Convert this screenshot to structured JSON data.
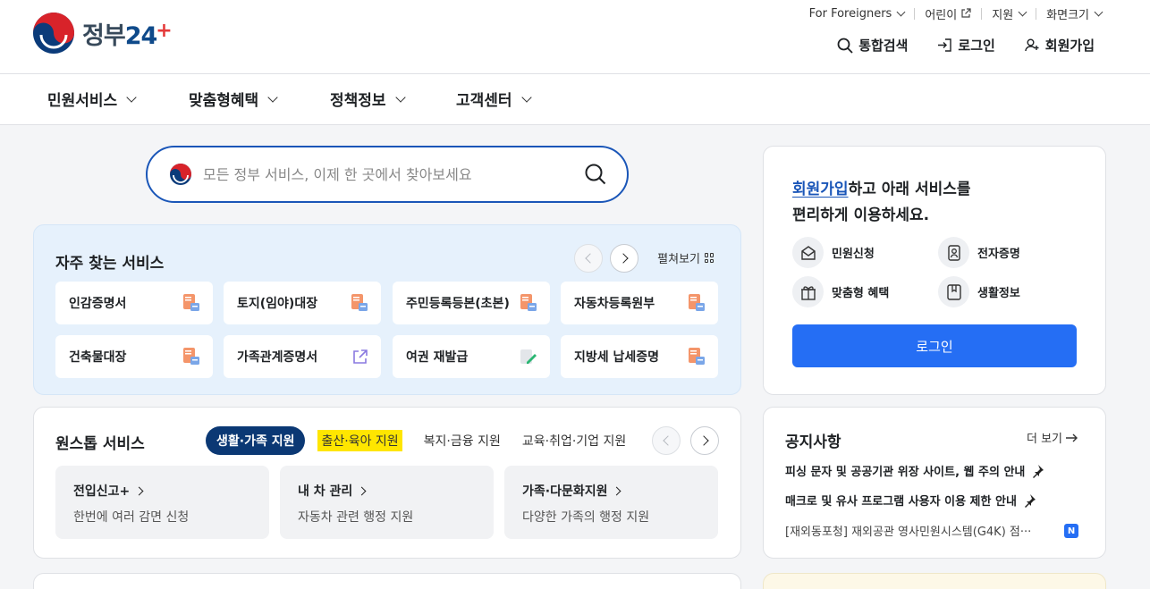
{
  "header": {
    "logo_text": "정부",
    "logo_num": "24",
    "logo_plus": "+",
    "util": [
      {
        "label": "For Foreigners",
        "type": "dropdown"
      },
      {
        "label": "어린이",
        "type": "external"
      },
      {
        "label": "지원",
        "type": "dropdown"
      },
      {
        "label": "화면크기",
        "type": "dropdown"
      }
    ],
    "links": {
      "search": "통합검색",
      "login": "로그인",
      "signup": "회원가입"
    }
  },
  "nav": {
    "items": [
      "민원서비스",
      "맞춤형혜택",
      "정책정보",
      "고객센터"
    ]
  },
  "search": {
    "placeholder": "모든 정부 서비스, 이제 한 곳에서 찾아보세요"
  },
  "frequent": {
    "title": "자주 찾는 서비스",
    "expand_label": "펼쳐보기",
    "items": [
      {
        "label": "인감증명서",
        "icon": "document-icon"
      },
      {
        "label": "토지(임야)대장",
        "icon": "document-icon"
      },
      {
        "label": "주민등록등본(초본)",
        "icon": "document-icon"
      },
      {
        "label": "자동차등록원부",
        "icon": "document-icon"
      },
      {
        "label": "건축물대장",
        "icon": "document-icon"
      },
      {
        "label": "가족관계증명서",
        "icon": "external-link-icon"
      },
      {
        "label": "여권 재발급",
        "icon": "edit-document-icon"
      },
      {
        "label": "지방세 납세증명",
        "icon": "document-icon"
      }
    ]
  },
  "onestop": {
    "title": "원스톱 서비스",
    "tabs": [
      "생활·가족 지원",
      "출산·육아 지원",
      "복지·금융 지원",
      "교육·취업·기업 지원"
    ],
    "active_tab": 0,
    "cards": [
      {
        "title": "전입신고+",
        "desc": "한번에 여러 감면 신청"
      },
      {
        "title": "내 차 관리",
        "desc": "자동차 관련 행정 지원"
      },
      {
        "title": "가족·다문화지원",
        "desc": "다양한 가족의 행정 지원"
      }
    ]
  },
  "login_box": {
    "msg_link": "회원가입",
    "msg_rest": "하고 아래 서비스를",
    "msg_line2": "편리하게 이용하세요.",
    "services": [
      "민원신청",
      "전자증명",
      "맞춤형 혜택",
      "생활정보"
    ],
    "button": "로그인"
  },
  "notice": {
    "title": "공지사항",
    "more": "더 보기",
    "items": [
      {
        "text": "피싱 문자 및 공공기관 위장 사이트, 웹 주의 안내",
        "pinned": true
      },
      {
        "text": "매크로 및 유사 프로그램 사용자 이용 제한 안내",
        "pinned": true
      },
      {
        "text": "[재외동포청] 재외공관 영사민원시스템(G4K) 점···",
        "pinned": false,
        "badge": "N"
      }
    ]
  },
  "colors": {
    "primary": "#256ef4",
    "navy": "#0b3874",
    "highlight": "#ffe600",
    "freq_bg": "#e6f1fc"
  }
}
